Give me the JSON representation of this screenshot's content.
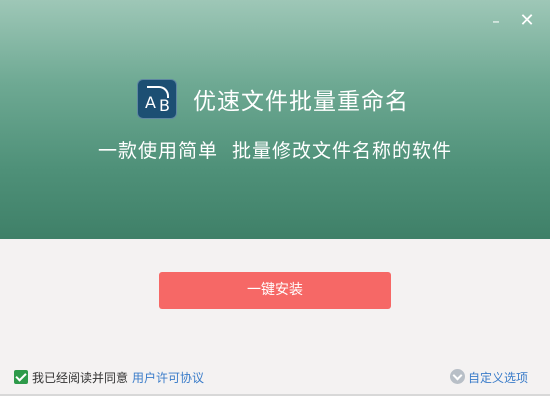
{
  "window": {
    "minimize_label": "–",
    "close_label": "✕"
  },
  "brand": {
    "logo_letter_a": "A",
    "logo_letter_b": "B",
    "title": "优速文件批量重命名"
  },
  "subtitle": "一款使用简单  批量修改文件名称的软件",
  "install": {
    "button_label": "一键安装"
  },
  "footer": {
    "agree_checked": true,
    "agree_text": "我已经阅读并同意",
    "license_link": "用户许可协议",
    "custom_link": "自定义选项"
  },
  "colors": {
    "header_top": "#9ec7b7",
    "header_bottom": "#3f8068",
    "install_button": "#f66866",
    "checkbox": "#2e9a4a",
    "link": "#3a7cc9"
  },
  "icons": [
    "minimize-icon",
    "close-icon",
    "app-logo-icon",
    "checkbox-checked-icon",
    "chevron-down-circle-icon"
  ]
}
